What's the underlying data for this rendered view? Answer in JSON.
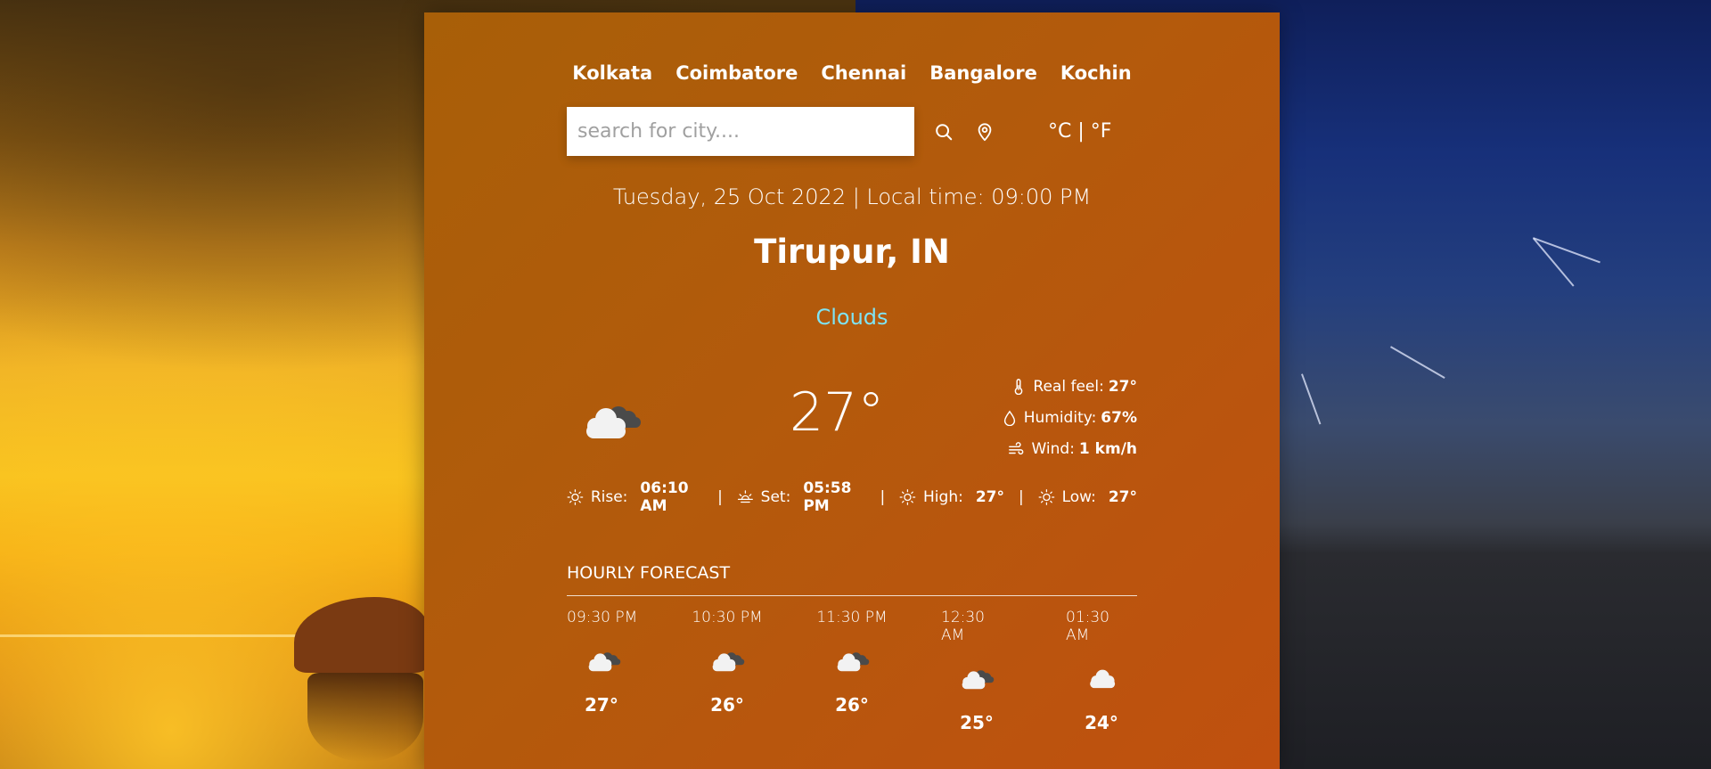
{
  "cities": [
    "Kolkata",
    "Coimbatore",
    "Chennai",
    "Bangalore",
    "Kochin"
  ],
  "search": {
    "placeholder": "search for city...."
  },
  "units": {
    "celsius": "°C",
    "separator": "|",
    "fahrenheit": "°F"
  },
  "datetime": "Tuesday, 25 Oct 2022 | Local time: 09:00 PM",
  "location": "Tirupur, IN",
  "condition": "Clouds",
  "current": {
    "icon": "broken-clouds-icon",
    "temperature": "27°",
    "real_feel_label": "Real feel:",
    "real_feel": "27°",
    "humidity_label": "Humidity:",
    "humidity": "67%",
    "wind_label": "Wind:",
    "wind": "1 km/h"
  },
  "sun": {
    "rise_label": "Rise:",
    "rise": "06:10 AM",
    "set_label": "Set:",
    "set": "05:58 PM",
    "high_label": "High:",
    "high": "27°",
    "low_label": "Low:",
    "low": "27°",
    "separator": "|"
  },
  "hourly": {
    "title": "HOURLY FORECAST",
    "items": [
      {
        "time": "09:30 PM",
        "icon": "broken-clouds-icon",
        "temp": "27°"
      },
      {
        "time": "10:30 PM",
        "icon": "broken-clouds-icon",
        "temp": "26°"
      },
      {
        "time": "11:30 PM",
        "icon": "broken-clouds-icon",
        "temp": "26°"
      },
      {
        "time": "12:30 AM",
        "icon": "broken-clouds-icon",
        "temp": "25°"
      },
      {
        "time": "01:30 AM",
        "icon": "cloud-icon",
        "temp": "24°"
      }
    ]
  },
  "colors": {
    "condition": "#7fe3f3",
    "card_start": "#a85f08",
    "card_end": "#c0500f"
  }
}
